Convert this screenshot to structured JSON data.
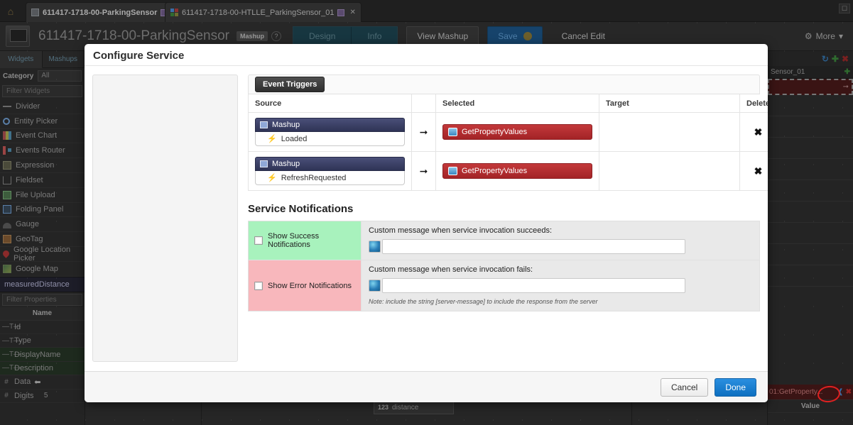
{
  "browser": {
    "home_icon": "home-icon",
    "tabs": [
      {
        "title": "611417-1718-00-ParkingSensor",
        "icon": "document-icon",
        "active": true
      },
      {
        "title": "611417-1718-00-HTLLE_ParkingSensor_01",
        "icon": "blocks-icon",
        "active": false
      }
    ],
    "window_control": "restore-icon"
  },
  "appbar": {
    "title": "611417-1718-00-ParkingSensor",
    "badge": "Mashup",
    "help_badge": "?",
    "segments": [
      "Design",
      "Info"
    ],
    "view_mashup": "View Mashup",
    "save": "Save",
    "cancel_edit": "Cancel Edit",
    "more": "More"
  },
  "sidebar": {
    "tabs": [
      "Widgets",
      "Mashups"
    ],
    "category_label": "Category",
    "category_value": "All",
    "filter_widgets_placeholder": "Filter Widgets",
    "widgets": [
      {
        "label": "Divider",
        "icon": "divider-icon"
      },
      {
        "label": "Entity Picker",
        "icon": "magnifier-icon"
      },
      {
        "label": "Event Chart",
        "icon": "chart-icon"
      },
      {
        "label": "Events Router",
        "icon": "router-icon"
      },
      {
        "label": "Expression",
        "icon": "expression-icon"
      },
      {
        "label": "Fieldset",
        "icon": "fieldset-icon"
      },
      {
        "label": "File Upload",
        "icon": "upload-icon"
      },
      {
        "label": "Folding Panel",
        "icon": "panel-icon"
      },
      {
        "label": "Gauge",
        "icon": "gauge-icon"
      },
      {
        "label": "GeoTag",
        "icon": "geotag-icon"
      },
      {
        "label": "Google Location Picker",
        "icon": "pin-icon"
      },
      {
        "label": "Google Map",
        "icon": "map-icon"
      }
    ],
    "selected_entity": "measuredDistance",
    "filter_properties_placeholder": "Filter Properties",
    "properties_header": "Name",
    "properties": [
      {
        "name": "Id",
        "type": "T",
        "value": ""
      },
      {
        "name": "Type",
        "type": "T",
        "value": ""
      },
      {
        "name": "DisplayName",
        "type": "T",
        "value": ""
      },
      {
        "name": "Description",
        "type": "T",
        "value": ""
      },
      {
        "name": "Data",
        "type": "#",
        "value": ""
      },
      {
        "name": "Digits",
        "type": "#",
        "value": "5"
      }
    ]
  },
  "rightpanel": {
    "toolbar_icons": [
      "refresh-icon",
      "add-icon",
      "close-icon"
    ],
    "title": "Sensor_01",
    "add_label": "+",
    "footer_label": "01:GetProperty...",
    "value_header": "Value"
  },
  "canvas": {
    "chip_prefix": "123",
    "chip_label": "distance"
  },
  "modal": {
    "title": "Configure Service",
    "tab": "Event Triggers",
    "columns": [
      "Source",
      "",
      "Selected",
      "Target",
      "Delete"
    ],
    "rows": [
      {
        "source_entity": "Mashup",
        "source_event": "Loaded",
        "arrow": "→",
        "selected_service": "GetPropertyValues",
        "target": "",
        "delete": "✖"
      },
      {
        "source_entity": "Mashup",
        "source_event": "RefreshRequested",
        "arrow": "→",
        "selected_service": "GetPropertyValues",
        "target": "",
        "delete": "✖"
      }
    ],
    "notifications": {
      "heading": "Service Notifications",
      "success": {
        "checkbox_label": "Show Success Notifications",
        "checked": false,
        "message_label": "Custom message when service invocation succeeds:",
        "message_value": ""
      },
      "error": {
        "checkbox_label": "Show Error Notifications",
        "checked": false,
        "message_label": "Custom message when service invocation fails:",
        "message_value": "",
        "note": "Note: include the string [server-message] to include the response from the server"
      }
    },
    "cancel": "Cancel",
    "done": "Done"
  },
  "colors": {
    "accent_blue": "#0d6fc0",
    "service_red": "#a32326",
    "source_navy": "#2f3456",
    "success_green": "#a8f2bd",
    "error_pink": "#f8b7bc",
    "annotation_red": "#e02020"
  }
}
